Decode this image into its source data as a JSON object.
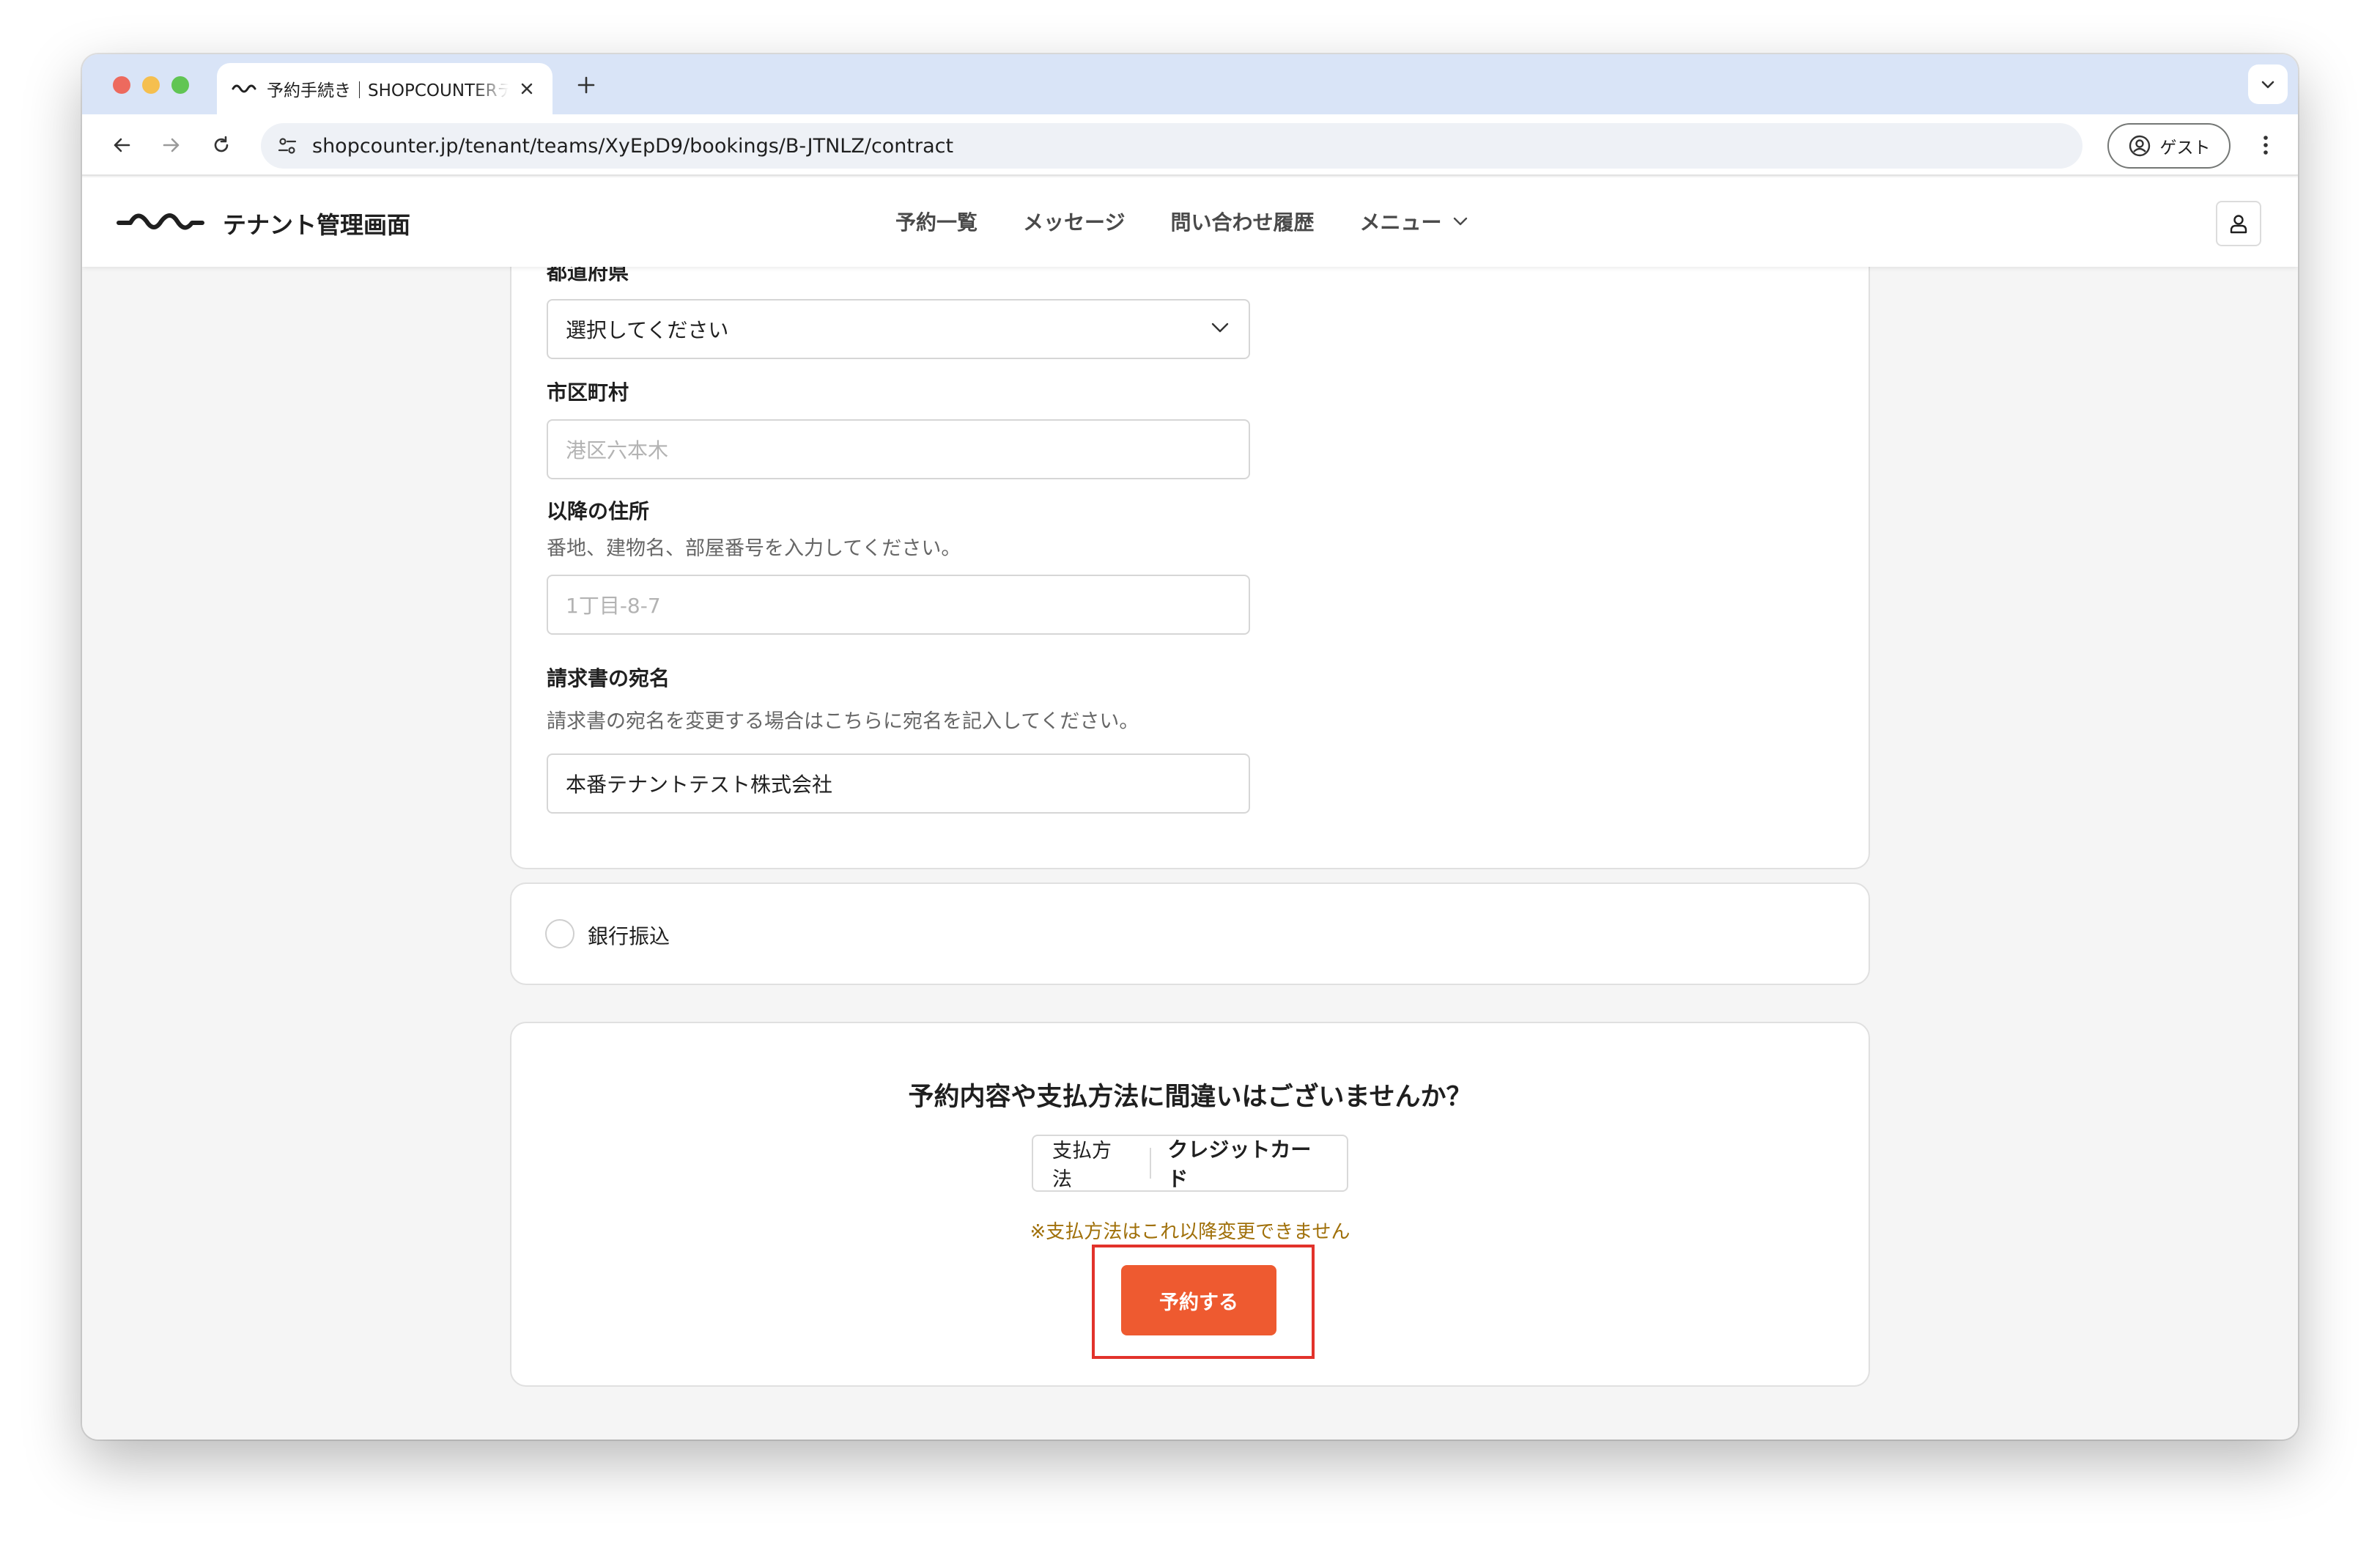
{
  "browser": {
    "tab_title": "予約手続き｜SHOPCOUNTERテナント管理画面",
    "url": "shopcounter.jp/tenant/teams/XyEpD9/bookings/B-JTNLZ/contract",
    "guest_label": "ゲスト"
  },
  "header": {
    "app_title": "テナント管理画面",
    "nav": {
      "bookings": "予約一覧",
      "messages": "メッセージ",
      "inquiries": "問い合わせ履歴",
      "menu": "メニュー"
    }
  },
  "form": {
    "prefecture": {
      "label": "都道府県",
      "value": "選択してください"
    },
    "city": {
      "label": "市区町村",
      "placeholder": "港区六本木"
    },
    "address": {
      "label": "以降の住所",
      "help": "番地、建物名、部屋番号を入力してください。",
      "placeholder": "1丁目-8-7"
    },
    "invoice_name": {
      "label": "請求書の宛名",
      "help": "請求書の宛名を変更する場合はこちらに宛名を記入してください。",
      "value": "本番テナントテスト株式会社"
    }
  },
  "payment_options": {
    "bank_transfer": "銀行振込"
  },
  "confirm": {
    "title": "予約内容や支払方法に間違いはございませんか？",
    "method_label": "支払方法",
    "method_value": "クレジットカード",
    "warning": "※支払方法はこれ以降変更できません",
    "submit_label": "予約する"
  },
  "colors": {
    "accent": "#ee5a30",
    "highlight": "#e2322b",
    "warning_text": "#a0700a",
    "tabstrip": "#d9e4f7"
  },
  "icons": {
    "favicon": "shopcounter-wave-icon",
    "logo": "shopcounter-logo-icon"
  }
}
